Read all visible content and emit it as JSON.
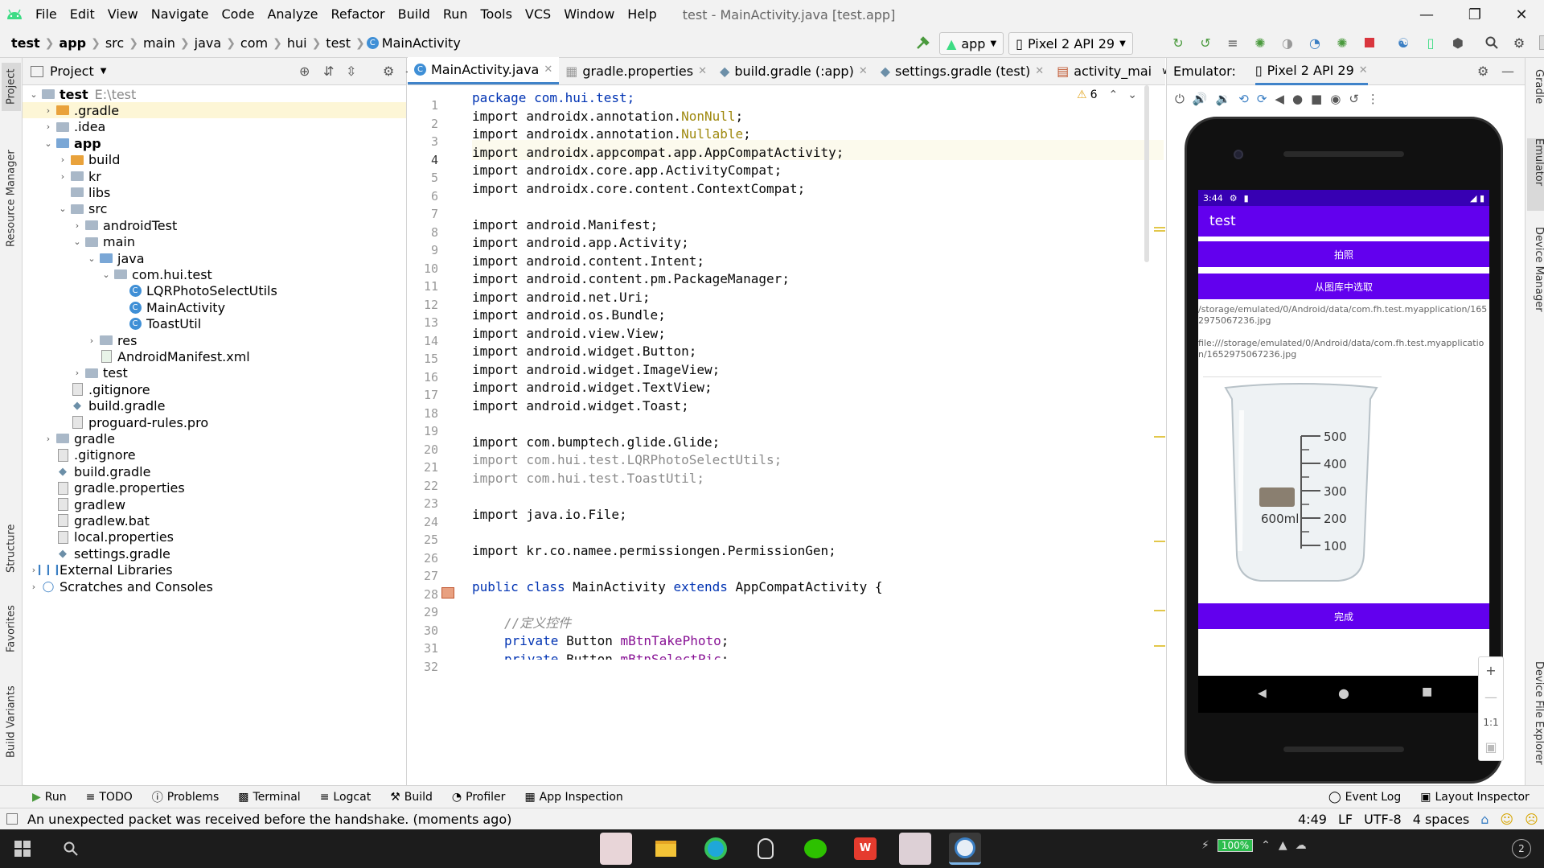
{
  "menubar": {
    "items": [
      "File",
      "Edit",
      "View",
      "Navigate",
      "Code",
      "Analyze",
      "Refactor",
      "Build",
      "Run",
      "Tools",
      "VCS",
      "Window",
      "Help"
    ],
    "window_title": "test - MainActivity.java [test.app]"
  },
  "navbar": {
    "breadcrumbs": [
      "test",
      "app",
      "src",
      "main",
      "java",
      "com",
      "hui",
      "test",
      "MainActivity"
    ],
    "run_config": "app",
    "device": "Pixel 2 API 29"
  },
  "left_strip": {
    "project": "Project",
    "resource_manager": "Resource Manager",
    "structure": "Structure",
    "favorites": "Favorites",
    "build_variants": "Build Variants"
  },
  "right_strip": {
    "gradle": "Gradle",
    "emulator": "Emulator",
    "device_manager": "Device Manager",
    "device_file_explorer": "Device File Explorer"
  },
  "project_panel": {
    "title": "Project",
    "tree": [
      {
        "label": "test",
        "hint": "E:\\test",
        "bold": true
      },
      {
        "label": ".gradle"
      },
      {
        "label": ".idea"
      },
      {
        "label": "app",
        "bold": true
      },
      {
        "label": "build"
      },
      {
        "label": "kr"
      },
      {
        "label": "libs"
      },
      {
        "label": "src"
      },
      {
        "label": "androidTest"
      },
      {
        "label": "main"
      },
      {
        "label": "java"
      },
      {
        "label": "com.hui.test"
      },
      {
        "label": "LQRPhotoSelectUtils"
      },
      {
        "label": "MainActivity"
      },
      {
        "label": "ToastUtil"
      },
      {
        "label": "res"
      },
      {
        "label": "AndroidManifest.xml"
      },
      {
        "label": "test"
      },
      {
        "label": ".gitignore"
      },
      {
        "label": "build.gradle"
      },
      {
        "label": "proguard-rules.pro"
      },
      {
        "label": "gradle"
      },
      {
        "label": ".gitignore"
      },
      {
        "label": "build.gradle"
      },
      {
        "label": "gradle.properties"
      },
      {
        "label": "gradlew"
      },
      {
        "label": "gradlew.bat"
      },
      {
        "label": "local.properties"
      },
      {
        "label": "settings.gradle"
      },
      {
        "label": "External Libraries"
      },
      {
        "label": "Scratches and Consoles"
      }
    ]
  },
  "editor": {
    "tabs": [
      "MainActivity.java",
      "gradle.properties",
      "build.gradle (:app)",
      "settings.gradle (test)",
      "activity_mai"
    ],
    "warnings": "6",
    "line_numbers": [
      "1",
      "2",
      "3",
      "4",
      "5",
      "6",
      "7",
      "8",
      "9",
      "10",
      "11",
      "12",
      "13",
      "14",
      "15",
      "16",
      "17",
      "18",
      "19",
      "20",
      "21",
      "22",
      "23",
      "24",
      "25",
      "26",
      "27",
      "28",
      "29",
      "30",
      "31",
      "32"
    ],
    "code": {
      "l1": "package com.hui.test;",
      "l2a": "import androidx.annotation.",
      "l2b": "NonNull",
      "l2c": ";",
      "l3a": "import androidx.annotation.",
      "l3b": "Nullable",
      "l3c": ";",
      "l4": "import androidx.appcompat.app.AppCompatActivity;",
      "l5": "import androidx.core.app.ActivityCompat;",
      "l6": "import androidx.core.content.ContextCompat;",
      "l8": "import android.Manifest;",
      "l9": "import android.app.Activity;",
      "l10": "import android.content.Intent;",
      "l11": "import android.content.pm.PackageManager;",
      "l12": "import android.net.Uri;",
      "l13": "import android.os.Bundle;",
      "l14": "import android.view.View;",
      "l15": "import android.widget.Button;",
      "l16": "import android.widget.ImageView;",
      "l17": "import android.widget.TextView;",
      "l18": "import android.widget.Toast;",
      "l20": "import com.bumptech.glide.Glide;",
      "l21": "import com.hui.test.LQRPhotoSelectUtils;",
      "l22": "import com.hui.test.ToastUtil;",
      "l24": "import java.io.File;",
      "l26": "import kr.co.namee.permissiongen.PermissionGen;",
      "l28a": "public class",
      "l28b": " MainActivity ",
      "l28c": "extends",
      "l28d": " AppCompatActivity {",
      "l30": "//定义控件",
      "l31a": "private",
      "l31b": " Button ",
      "l31c": "mBtnTakePhoto",
      "l31d": ";",
      "l32a": "private",
      "l32b": " Button ",
      "l32c": "mBtnSelectPic",
      "l32d": ";"
    }
  },
  "emulator": {
    "label": "Emulator:",
    "device_tab": "Pixel 2 API 29",
    "zoom_label": "1:1",
    "phone": {
      "time": "3:44",
      "app_title": "test",
      "btn_take_photo": "拍照",
      "btn_select": "从图库中选取",
      "path1": "/storage/emulated/0/Android/data/com.fh.test.myapplication/1652975067236.jpg",
      "path2": "file:///storage/emulated/0/Android/data/com.fh.test.myapplication/1652975067236.jpg",
      "beaker_ticks": [
        "500",
        "400",
        "300",
        "200",
        "100"
      ],
      "beaker_label": "600ml",
      "btn_done": "完成"
    }
  },
  "toolwindows": {
    "left": [
      "Run",
      "TODO",
      "Problems",
      "Terminal",
      "Logcat",
      "Build",
      "Profiler",
      "App Inspection"
    ],
    "right": [
      "Event Log",
      "Layout Inspector"
    ]
  },
  "status": {
    "message": "An unexpected packet was received before the handshake. (moments ago)",
    "position": "4:49",
    "line_sep": "LF",
    "encoding": "UTF-8",
    "indent": "4 spaces"
  },
  "taskbar": {
    "battery": "100%"
  },
  "colors": {
    "accent": "#6200ee",
    "android_green": "#3ddc84",
    "tab_underline": "#4083c9"
  }
}
